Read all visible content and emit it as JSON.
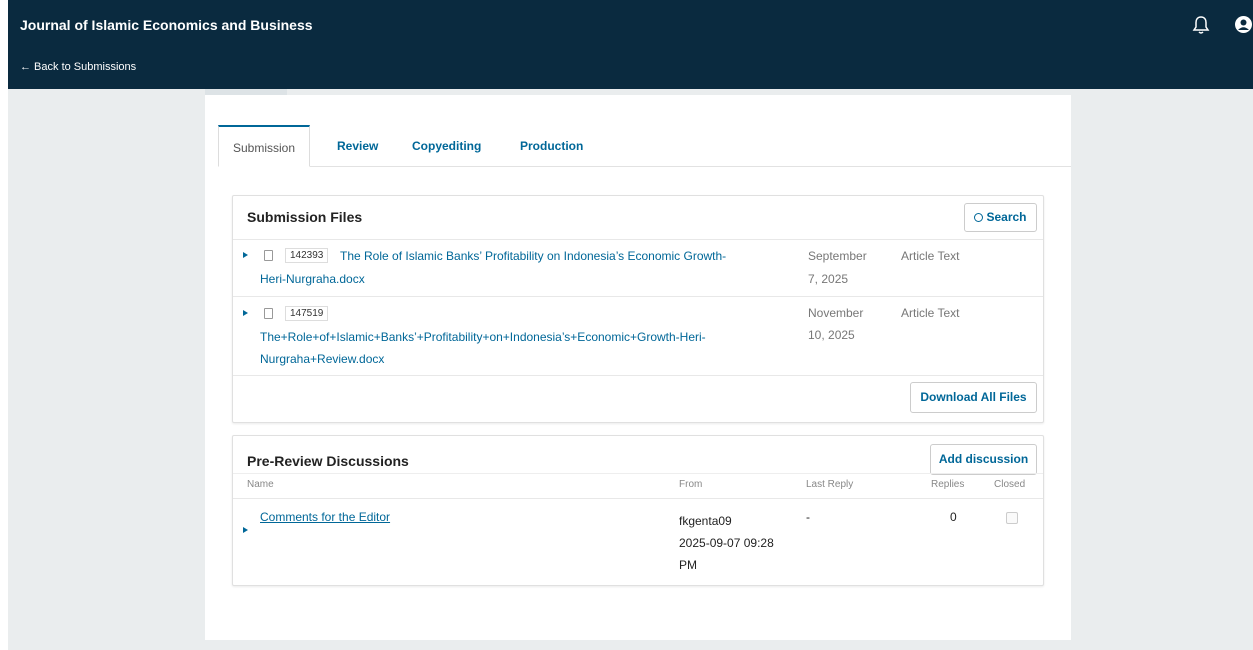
{
  "header": {
    "site_title": "Journal of Islamic Economics and Business",
    "back_link": "← Back to Submissions",
    "icons": [
      "bell-icon",
      "user-icon"
    ]
  },
  "tabs": [
    {
      "label": "Submission",
      "active": true
    },
    {
      "label": "Review",
      "active": false
    },
    {
      "label": "Copyediting",
      "active": false
    },
    {
      "label": "Production",
      "active": false
    }
  ],
  "submission_files": {
    "title": "Submission Files",
    "search_label": "Search",
    "download_all_label": "Download All Files",
    "files": [
      {
        "id": "142393",
        "name_line1": "The Role of Islamic Banks’ Profitability on Indonesia’s Economic Growth-",
        "name_line2": "Heri-Nurgraha.docx",
        "date_line1": "September",
        "date_line2": "7, 2025",
        "type": "Article Text"
      },
      {
        "id": "147519",
        "name_line1": "The+Role+of+Islamic+Banks’+Profitability+on+Indonesia’s+Economic+Growth-Heri-",
        "name_line2": "Nurgraha+Review.docx",
        "date_line1": "November",
        "date_line2": "10, 2025",
        "type": "Article Text"
      }
    ]
  },
  "discussions": {
    "title": "Pre-Review Discussions",
    "add_label": "Add discussion",
    "columns": [
      "Name",
      "From",
      "Last Reply",
      "Replies",
      "Closed"
    ],
    "rows": [
      {
        "name": "Comments for the Editor",
        "from_user": "fkgenta09",
        "from_date": "2025-09-07 09:28",
        "from_time": "PM",
        "last_reply": "-",
        "replies": "0",
        "closed": false
      }
    ]
  },
  "colors": {
    "header_bg": "#0a2a3f",
    "link": "#006798",
    "page_bg": "#eaedee"
  }
}
